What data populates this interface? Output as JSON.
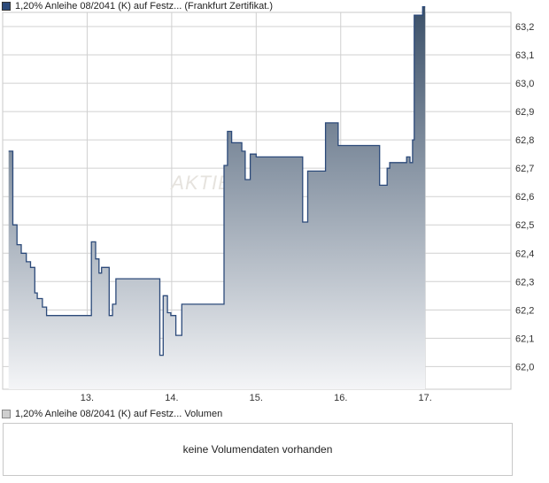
{
  "legend": {
    "price_series": "1,20% Anleihe 08/2041 (K) auf Festz... (Frankfurt Zertifikat.)",
    "volume_series": "1,20% Anleihe 08/2041 (K) auf Festz... Volumen"
  },
  "watermark": "AKTIEN",
  "volume_panel": {
    "message": "keine Volumendaten vorhanden"
  },
  "colors": {
    "line": "#2c4a7a",
    "fill_top": "#3b5069",
    "fill_bottom": "#f4f5f7",
    "grid": "#d0d0d0"
  },
  "chart_data": {
    "type": "area",
    "title": "",
    "xlabel": "",
    "ylabel": "",
    "ylim": [
      61.92,
      63.25
    ],
    "x_ticks": [
      "13.",
      "14.",
      "15.",
      "16.",
      "17."
    ],
    "y_ticks": [
      "62,0",
      "62,1",
      "62,2",
      "62,3",
      "62,4",
      "62,5",
      "62,6",
      "62,7",
      "62,8",
      "62,9",
      "63,0",
      "63,1",
      "63,2"
    ],
    "y_tick_values": [
      62.0,
      62.1,
      62.2,
      62.3,
      62.4,
      62.5,
      62.6,
      62.7,
      62.8,
      62.9,
      63.0,
      63.1,
      63.2
    ],
    "grid": true,
    "series": [
      {
        "values": [
          [
            12.07,
            62.76
          ],
          [
            12.12,
            62.76
          ],
          [
            12.12,
            62.5
          ],
          [
            12.17,
            62.5
          ],
          [
            12.17,
            62.43
          ],
          [
            12.22,
            62.43
          ],
          [
            12.22,
            62.4
          ],
          [
            12.28,
            62.4
          ],
          [
            12.28,
            62.37
          ],
          [
            12.33,
            62.37
          ],
          [
            12.33,
            62.35
          ],
          [
            12.38,
            62.35
          ],
          [
            12.38,
            62.26
          ],
          [
            12.41,
            62.26
          ],
          [
            12.41,
            62.24
          ],
          [
            12.47,
            62.24
          ],
          [
            12.47,
            62.21
          ],
          [
            12.52,
            62.21
          ],
          [
            12.52,
            62.18
          ],
          [
            13.05,
            62.18
          ],
          [
            13.05,
            62.44
          ],
          [
            13.1,
            62.44
          ],
          [
            13.1,
            62.38
          ],
          [
            13.14,
            62.38
          ],
          [
            13.14,
            62.33
          ],
          [
            13.17,
            62.33
          ],
          [
            13.17,
            62.35
          ],
          [
            13.26,
            62.35
          ],
          [
            13.26,
            62.18
          ],
          [
            13.3,
            62.18
          ],
          [
            13.3,
            62.22
          ],
          [
            13.34,
            62.22
          ],
          [
            13.34,
            62.31
          ],
          [
            13.86,
            62.31
          ],
          [
            13.86,
            62.04
          ],
          [
            13.9,
            62.04
          ],
          [
            13.9,
            62.25
          ],
          [
            13.95,
            62.25
          ],
          [
            13.95,
            62.19
          ],
          [
            13.99,
            62.19
          ],
          [
            13.99,
            62.18
          ],
          [
            14.05,
            62.18
          ],
          [
            14.05,
            62.11
          ],
          [
            14.12,
            62.11
          ],
          [
            14.12,
            62.22
          ],
          [
            14.62,
            62.22
          ],
          [
            14.62,
            62.71
          ],
          [
            14.66,
            62.71
          ],
          [
            14.66,
            62.83
          ],
          [
            14.71,
            62.83
          ],
          [
            14.71,
            62.79
          ],
          [
            14.83,
            62.79
          ],
          [
            14.83,
            62.76
          ],
          [
            14.87,
            62.76
          ],
          [
            14.87,
            62.66
          ],
          [
            14.93,
            62.66
          ],
          [
            14.93,
            62.75
          ],
          [
            15.0,
            62.75
          ],
          [
            15.0,
            62.74
          ],
          [
            15.55,
            62.74
          ],
          [
            15.55,
            62.51
          ],
          [
            15.61,
            62.51
          ],
          [
            15.61,
            62.69
          ],
          [
            15.82,
            62.69
          ],
          [
            15.82,
            62.86
          ],
          [
            15.97,
            62.86
          ],
          [
            15.97,
            62.78
          ],
          [
            16.46,
            62.78
          ],
          [
            16.46,
            62.64
          ],
          [
            16.55,
            62.64
          ],
          [
            16.55,
            62.7
          ],
          [
            16.58,
            62.7
          ],
          [
            16.58,
            62.72
          ],
          [
            16.78,
            62.72
          ],
          [
            16.78,
            62.74
          ],
          [
            16.82,
            62.74
          ],
          [
            16.82,
            62.72
          ],
          [
            16.85,
            62.72
          ],
          [
            16.85,
            62.8
          ],
          [
            16.87,
            62.8
          ],
          [
            16.87,
            63.24
          ],
          [
            16.97,
            63.24
          ],
          [
            16.97,
            63.27
          ],
          [
            17.0,
            63.27
          ]
        ]
      }
    ]
  }
}
